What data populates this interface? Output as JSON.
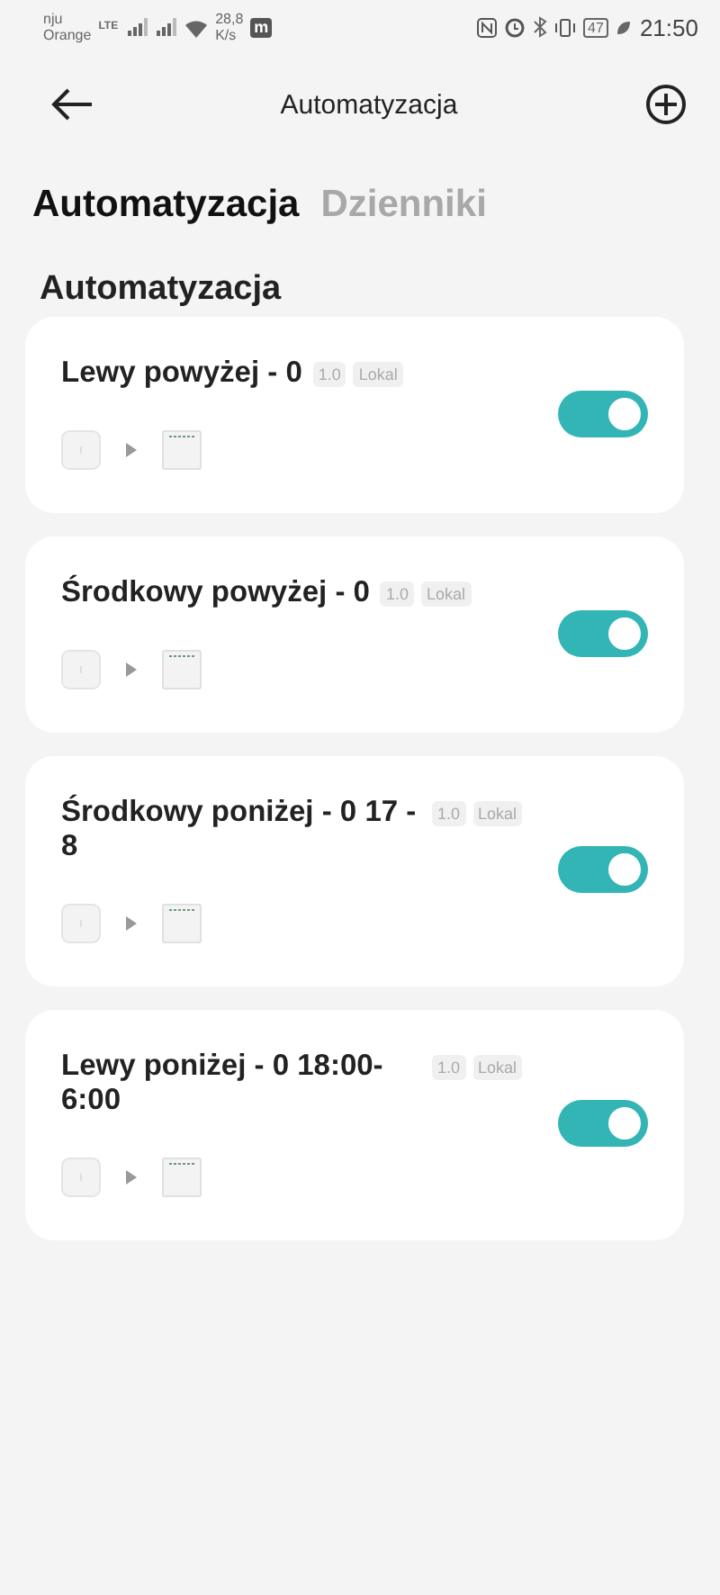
{
  "status_bar": {
    "carrier_top": "nju",
    "carrier": "Orange",
    "network": "LTE",
    "speed_value": "28,8",
    "speed_unit": "K/s",
    "app_badge": "m",
    "battery": "47",
    "time": "21:50"
  },
  "header": {
    "title": "Automatyzacja"
  },
  "tabs": [
    {
      "label": "Automatyzacja",
      "selected": true
    },
    {
      "label": "Dzienniki",
      "selected": false
    }
  ],
  "section_title": "Automatyzacja",
  "automations": [
    {
      "name": "Lewy powyżej - 0",
      "version": "1.0",
      "scope": "Lokal",
      "on": true
    },
    {
      "name": "Środkowy powyżej - 0",
      "version": "1.0",
      "scope": "Lokal",
      "on": true
    },
    {
      "name": "Środkowy poniżej - 0 17 - 8",
      "version": "1.0",
      "scope": "Lokal",
      "on": true
    },
    {
      "name": "Lewy poniżej - 0 18:00-6:00",
      "version": "1.0",
      "scope": "Lokal",
      "on": true
    }
  ]
}
